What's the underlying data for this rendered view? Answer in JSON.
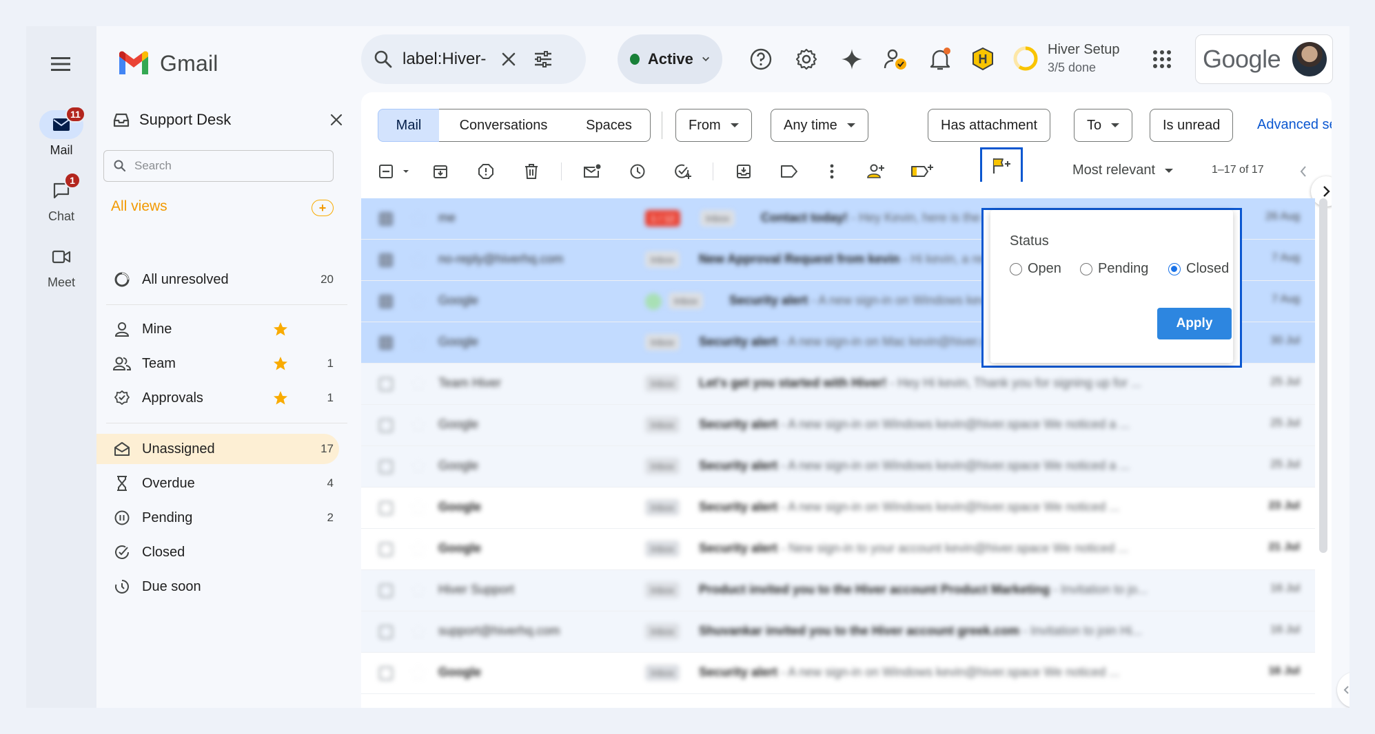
{
  "app": {
    "name": "Gmail"
  },
  "rail": {
    "items": [
      {
        "label": "Mail",
        "badge": "11"
      },
      {
        "label": "Chat",
        "badge": "1"
      },
      {
        "label": "Meet"
      }
    ]
  },
  "search": {
    "value": "label:Hiver-"
  },
  "status_pill": {
    "label": "Active"
  },
  "hiver_setup": {
    "title": "Hiver Setup",
    "progress": "3/5 done"
  },
  "account": {
    "brand": "Google"
  },
  "panel": {
    "title": "Support Desk",
    "search_placeholder": "Search",
    "all_views_label": "All views",
    "add_label": "+",
    "items": [
      {
        "label": "All unresolved",
        "count": "20"
      },
      {
        "label": "Mine",
        "count": ""
      },
      {
        "label": "Team",
        "count": "1"
      },
      {
        "label": "Approvals",
        "count": "1"
      },
      {
        "label": "Unassigned",
        "count": "17"
      },
      {
        "label": "Overdue",
        "count": "4"
      },
      {
        "label": "Pending",
        "count": "2"
      },
      {
        "label": "Closed",
        "count": ""
      },
      {
        "label": "Due soon",
        "count": ""
      }
    ]
  },
  "filters": {
    "segments": [
      "Mail",
      "Conversations",
      "Spaces"
    ],
    "chips": [
      "From",
      "Any time",
      "Has attachment",
      "To",
      "Is unread"
    ],
    "advanced": "Advanced search"
  },
  "toolbar": {
    "sort_label": "Most relevant",
    "range": "1–17 of 17"
  },
  "emails": [
    {
      "sender": "me",
      "tag": "1 / 12",
      "tag2": "Inbox",
      "subject": "Contact today!",
      "snippet": " - Hey Kevin, here is the note from our chat",
      "date": "26 Aug"
    },
    {
      "sender": "no-reply@hiverhq.com",
      "tag": "Inbox",
      "subject": "New Approval Request from kevin",
      "snippet": " - Hi kevin, a request needs your review",
      "date": "7 Aug"
    },
    {
      "sender": "Google",
      "tag": "Inbox",
      "subject": "Security alert",
      "snippet": " - A new sign-in on Windows kevin@hiver.space",
      "date": "7 Aug"
    },
    {
      "sender": "Google",
      "tag": "Inbox",
      "subject": "Security alert",
      "snippet": " - A new sign-in on Mac kevin@hiver.space We noticed a new",
      "date": "30 Jul"
    },
    {
      "sender": "Team Hiver",
      "tag": "Inbox",
      "subject": "Let's get you started with Hiver!",
      "snippet": " - Hey Hi kevin, Thank you for signing up for ...",
      "date": "25 Jul"
    },
    {
      "sender": "Google",
      "tag": "Inbox",
      "subject": "Security alert",
      "snippet": " - A new sign-in on Windows kevin@hiver.space We noticed a ...",
      "date": "25 Jul"
    },
    {
      "sender": "Google",
      "tag": "Inbox",
      "subject": "Security alert",
      "snippet": " - A new sign-in on Windows kevin@hiver.space We noticed a ...",
      "date": "25 Jul"
    },
    {
      "sender": "Google",
      "tag": "Inbox",
      "subject": "Security alert",
      "snippet": " - A new sign-in on Windows kevin@hiver.space We noticed ...",
      "date": "23 Jul"
    },
    {
      "sender": "Google",
      "tag": "Inbox",
      "subject": "Security alert",
      "snippet": " - New sign-in to your account kevin@hiver.space We noticed ...",
      "date": "21 Jul"
    },
    {
      "sender": "Hiver Support",
      "tag": "Inbox",
      "subject": "Product invited you to the Hiver account Product Marketing",
      "snippet": " - Invitation to jo...",
      "date": "16 Jul"
    },
    {
      "sender": "support@hiverhq.com",
      "tag": "Inbox",
      "subject": "Shuvankar invited you to the Hiver account greek.com",
      "snippet": " - Invitation to join Hi...",
      "date": "16 Jul"
    },
    {
      "sender": "Google",
      "tag": "Inbox",
      "subject": "Security alert",
      "snippet": " - A new sign-in on Windows kevin@hiver.space We noticed ...",
      "date": "16 Jul"
    }
  ],
  "status_popup": {
    "title": "Status",
    "options": [
      "Open",
      "Pending",
      "Closed"
    ],
    "selected": "Closed",
    "apply_label": "Apply"
  },
  "colors": {
    "selected_row": "#c2dbff",
    "accent_blue": "#0b57d0",
    "apply_button": "#2d86e0",
    "all_views": "#f29900",
    "unassigned_bg": "#fdefd4"
  }
}
